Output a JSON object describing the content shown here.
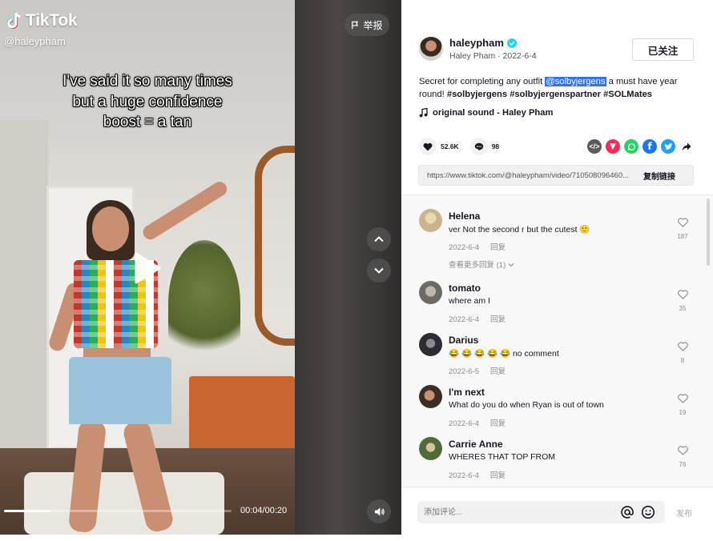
{
  "video": {
    "brand": "TikTok",
    "watermark_user": "@haleypham",
    "report_label": "举报",
    "caption_lines": [
      "I've said it so many times",
      "but a huge confidence",
      "boost = a tan"
    ],
    "time": "00:04/00:20",
    "progress": 0.2
  },
  "author": {
    "username": "haleypham",
    "display_line": "Haley Pham · 2022-6-4",
    "follow_label": "已关注"
  },
  "description": {
    "text_before": "Secret for completing any outfit ",
    "mention": "@solbyjergens",
    "text_after": " a must have year round! ",
    "hashtags": "#solbyjergens #solbyjergenspartner #SOLMates"
  },
  "sound": "original sound - Haley Pham",
  "stats": {
    "likes": "52.6K",
    "comments": "98"
  },
  "link": {
    "url": "https://www.tiktok.com/@haleypham/video/710508096460...",
    "copy_label": "复制链接"
  },
  "comments": [
    {
      "name": "Helena",
      "text": "ver Not the second r but the cutest 🙂",
      "date": "2022-6-4",
      "reply": "回复",
      "likes": "187",
      "more": "查看更多回复 (1)",
      "avatar_color": "#c9b48f"
    },
    {
      "name": "tomato",
      "text": "where am I",
      "date": "2022-6-4",
      "reply": "回复",
      "likes": "35",
      "avatar_color": "#6d6a66"
    },
    {
      "name": "Darius",
      "text": "😂 😂 😂 😂 😂  no comment",
      "date": "2022-6-5",
      "reply": "回复",
      "likes": "8",
      "avatar_color": "#2b2d33"
    },
    {
      "name": "I'm next",
      "text": "What do you do when Ryan is out of town",
      "date": "2022-6-4",
      "reply": "回复",
      "likes": "19",
      "avatar_color": "#3b2e25"
    },
    {
      "name": "Carrie Anne",
      "text": "WHERES THAT TOP FROM",
      "date": "2022-6-4",
      "reply": "回复",
      "likes": "76",
      "avatar_color": "#4f6b3a"
    }
  ],
  "composer": {
    "placeholder": "添加评论...",
    "post_label": "发布"
  },
  "colors": {
    "accent_mention": "#2f73f6",
    "verified": "#20d5ec",
    "brand_red": "#fe2c55"
  }
}
